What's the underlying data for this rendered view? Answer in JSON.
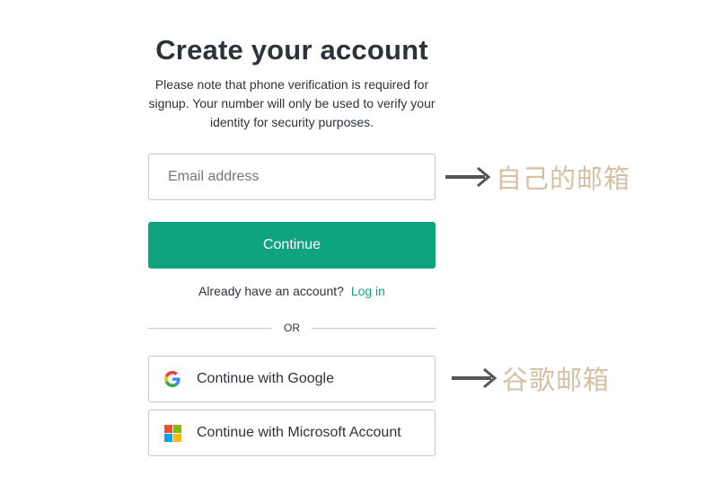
{
  "header": {
    "title": "Create your account",
    "subtitle": "Please note that phone verification is required for signup. Your number will only be used to verify your identity for security purposes."
  },
  "form": {
    "email_placeholder": "Email address",
    "email_value": "",
    "continue_label": "Continue"
  },
  "login": {
    "prompt": "Already have an account?",
    "link_label": "Log in"
  },
  "divider": {
    "label": "OR"
  },
  "social": {
    "google_label": "Continue with Google",
    "microsoft_label": "Continue with Microsoft Account",
    "google_icon": "google-g-icon",
    "microsoft_icon": "microsoft-logo-icon"
  },
  "annotations": [
    {
      "text": "自己的邮箱",
      "icon": "arrow-right-icon"
    },
    {
      "text": "谷歌邮箱",
      "icon": "arrow-right-icon"
    }
  ],
  "colors": {
    "accent": "#10a37f",
    "text": "#2d333a",
    "border": "#c2c8d0",
    "annotation": "#d6bfa3",
    "arrow": "#555555"
  }
}
